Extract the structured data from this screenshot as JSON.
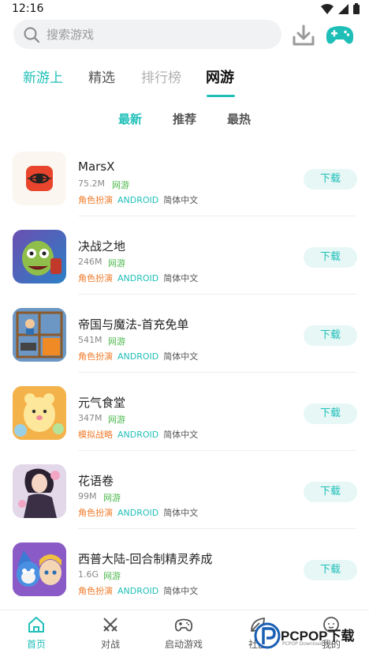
{
  "status_bar": {
    "time": "12:16"
  },
  "search": {
    "placeholder": "搜索游戏"
  },
  "tabs": [
    {
      "label": "新游上",
      "color": "#1fbfb8"
    },
    {
      "label": "精选",
      "color": "#555555"
    },
    {
      "label": "排行榜",
      "color": "#b0b0b0"
    },
    {
      "label": "网游",
      "color": "#111111"
    }
  ],
  "subtabs": [
    {
      "label": "最新",
      "color": "#1fbfb8"
    },
    {
      "label": "推荐",
      "color": "#555555"
    },
    {
      "label": "最热",
      "color": "#555555"
    }
  ],
  "games": [
    {
      "name": "MarsX",
      "size": "75.2M",
      "badge": "网游",
      "genre": "角色扮演",
      "platform": "ANDROID",
      "language": "简体中文",
      "button": "下载",
      "icon": "marsx-logo"
    },
    {
      "name": "决战之地",
      "size": "246M",
      "badge": "网游",
      "genre": "角色扮演",
      "platform": "ANDROID",
      "language": "简体中文",
      "button": "下载",
      "icon": "zombie-icon"
    },
    {
      "name": "帝国与魔法-首充免单",
      "size": "541M",
      "badge": "网游",
      "genre": "角色扮演",
      "platform": "ANDROID",
      "language": "简体中文",
      "button": "下载",
      "icon": "puzzle-tower-icon"
    },
    {
      "name": "元气食堂",
      "size": "347M",
      "badge": "网游",
      "genre": "模拟战略",
      "platform": "ANDROID",
      "language": "简体中文",
      "button": "下载",
      "icon": "cute-bear-icon"
    },
    {
      "name": "花语卷",
      "size": "99M",
      "badge": "网游",
      "genre": "角色扮演",
      "platform": "ANDROID",
      "language": "简体中文",
      "button": "下载",
      "icon": "anime-girl-icon"
    },
    {
      "name": "西普大陆-回合制精灵养成",
      "size": "1.6G",
      "badge": "网游",
      "genre": "角色扮演",
      "platform": "ANDROID",
      "language": "简体中文",
      "button": "下载",
      "icon": "fox-character-icon"
    }
  ],
  "bottom_nav": [
    {
      "label": "首页",
      "icon": "home-icon",
      "active": true
    },
    {
      "label": "对战",
      "icon": "crossed-swords-icon",
      "active": false
    },
    {
      "label": "启动游戏",
      "icon": "gamepad-icon",
      "active": false
    },
    {
      "label": "社区",
      "icon": "leaf-icon",
      "active": false
    },
    {
      "label": "我的",
      "icon": "face-icon",
      "active": false
    }
  ],
  "watermark": {
    "brand": "PCPOP下载",
    "sub": "PCPOP Download Site"
  },
  "colors": {
    "accent": "#1fbfb8",
    "genre": "#f07b2b",
    "badge": "#4cb84c"
  }
}
